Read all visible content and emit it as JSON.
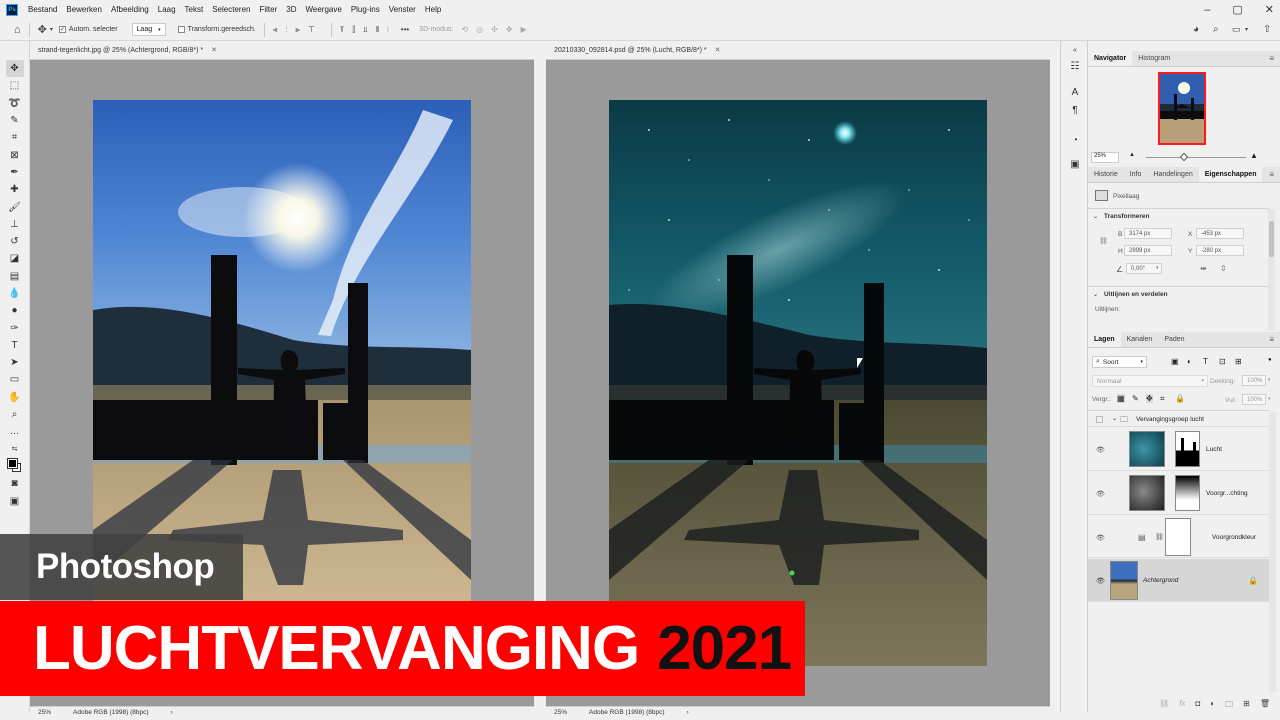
{
  "menubar": {
    "logo": "Ps",
    "items": [
      "Bestand",
      "Bewerken",
      "Afbeelding",
      "Laag",
      "Tekst",
      "Selecteren",
      "Filter",
      "3D",
      "Weergave",
      "Plug-ins",
      "Venster",
      "Help"
    ]
  },
  "options": {
    "auto_select_label": "Autom. selecter",
    "auto_select_target": "Laag",
    "transform_label": "Transform.gereedsch.",
    "mode_3d": "3D-modus:"
  },
  "documents": [
    {
      "tab_title": "strand-tegenlicht.jpg @ 25% (Achtergrond, RGB/8*) *",
      "zoom": "25%",
      "profile": "Adobe RGB (1998) (8bpc)"
    },
    {
      "tab_title": "20210330_092814.psd @ 25% (Lucht, RGB/8*) *",
      "zoom": "25%",
      "profile": "Adobe RGB (1998) (8bpc)"
    }
  ],
  "navigator": {
    "tabs": [
      "Navigator",
      "Histogram"
    ],
    "zoom": "25%"
  },
  "properties": {
    "tabs": [
      "Historie",
      "Info",
      "Handelingen",
      "Eigenschappen"
    ],
    "layer_type": "Pixellaag",
    "transform_header": "Transformeren",
    "w": "3174 px",
    "h": "2899 px",
    "x": "-453 px",
    "y": "-280 px",
    "w_label": "B",
    "h_label": "H",
    "x_label": "X",
    "y_label": "Y",
    "angle": "0,00°",
    "align_header": "Uitlijnen en verdelen",
    "align_label": "Uitlijnen:"
  },
  "layers": {
    "tabs": [
      "Lagen",
      "Kanalen",
      "Paden"
    ],
    "kind": "Soort",
    "blend_mode": "Normaal",
    "opacity_label": "Dekking:",
    "opacity": "100%",
    "lock_label": "Vergr.:",
    "fill_label": "Vul:",
    "fill": "100%",
    "items": [
      {
        "name": "Vervangingsgroep lucht"
      },
      {
        "name": "Lucht"
      },
      {
        "name": "Voorgr...chting"
      },
      {
        "name": "Voorgrondkleur"
      },
      {
        "name": "Achtergrond"
      }
    ]
  },
  "overlay": {
    "app": "Photoshop",
    "title_word": "LUCHTVERVANGING",
    "title_year": "2021"
  }
}
